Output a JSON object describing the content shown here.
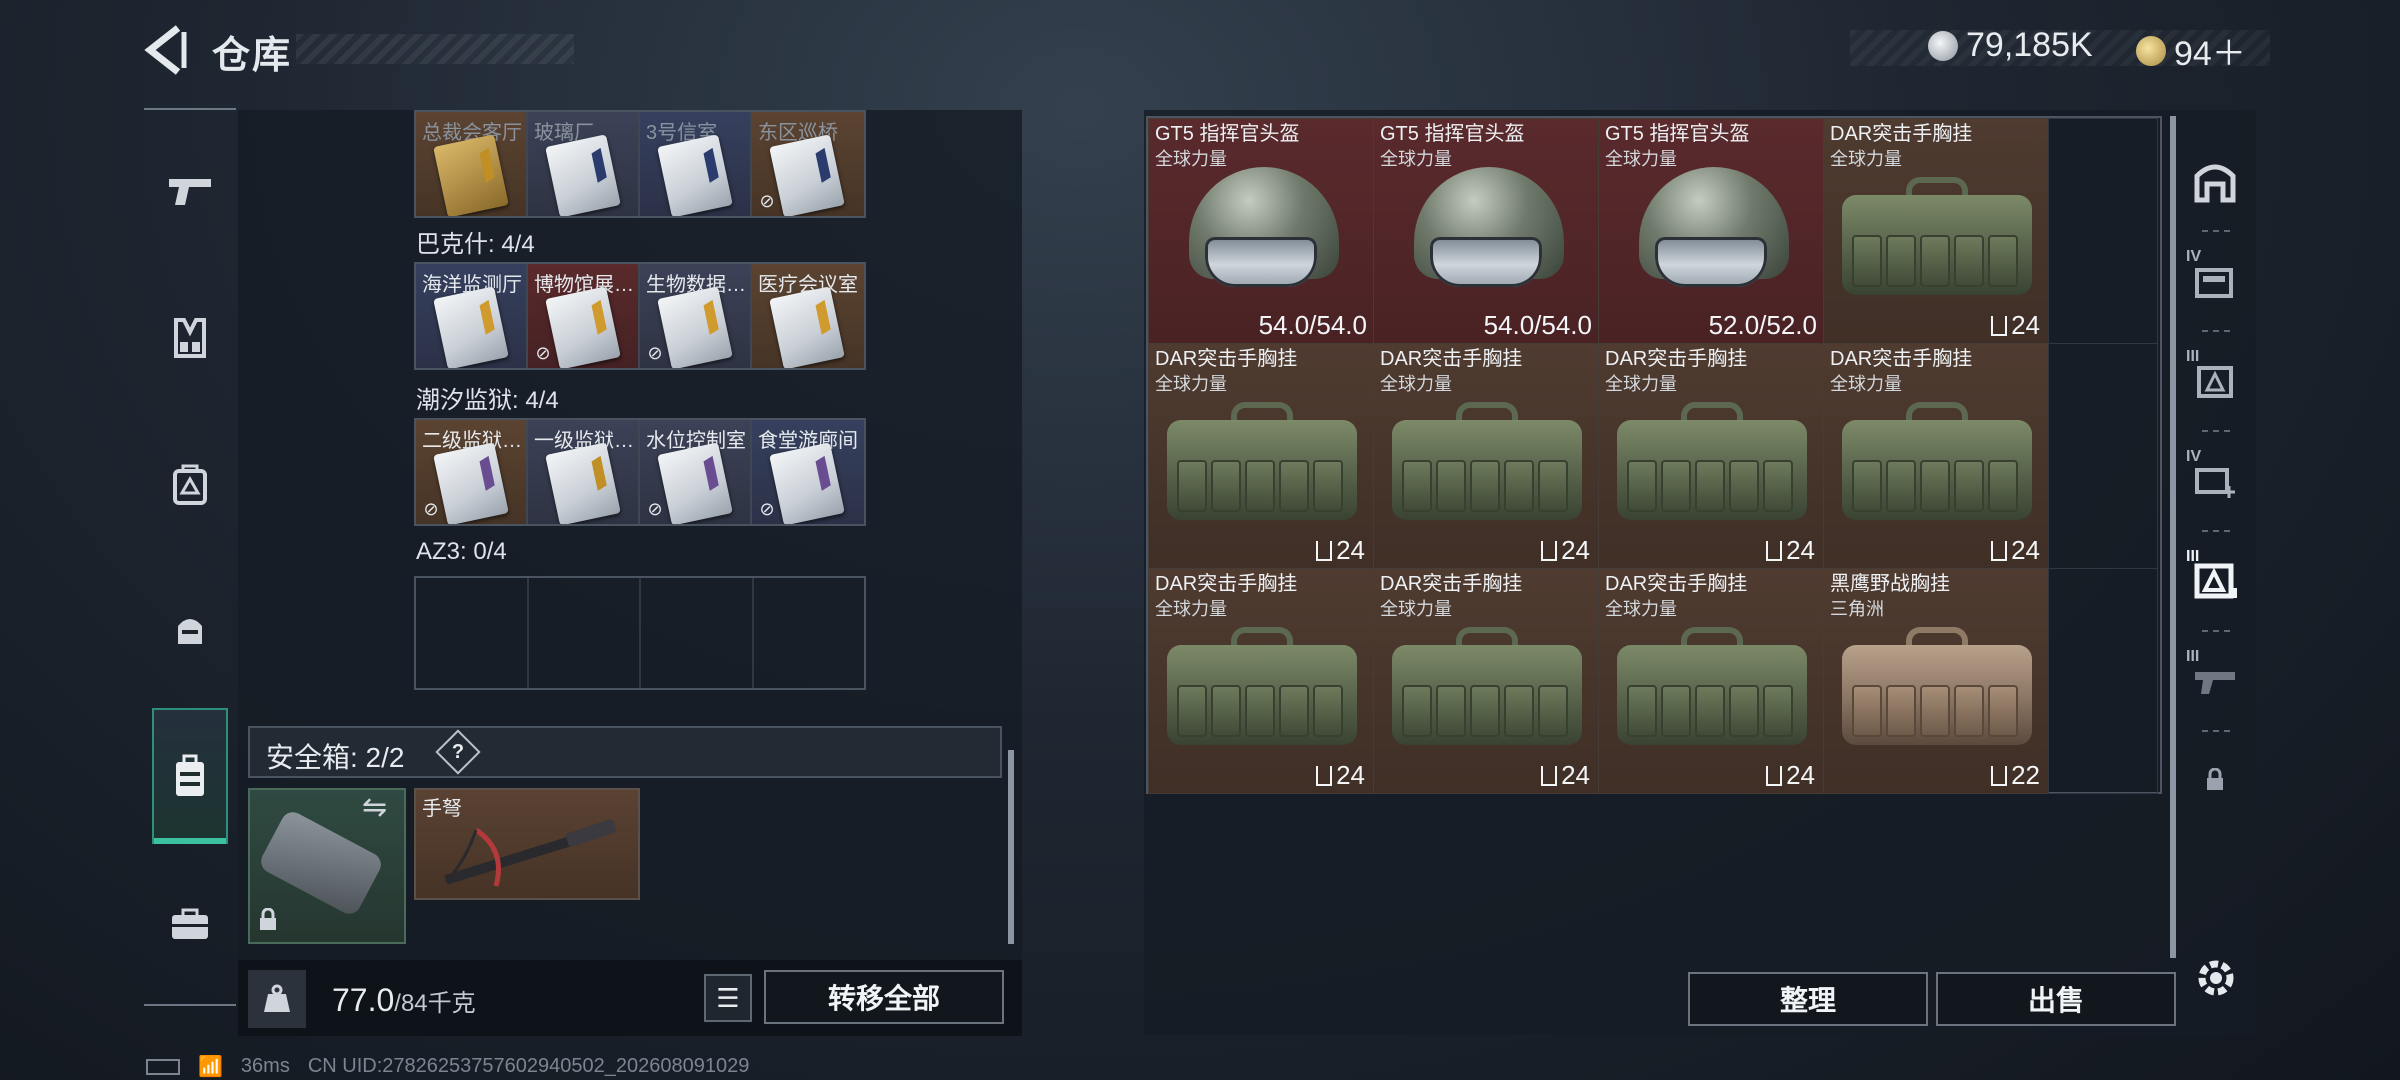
{
  "header": {
    "title": "仓库",
    "silver_amount": "79,185K",
    "gold_amount": "94＋"
  },
  "left_rail": {
    "items": [
      "pistol-icon",
      "vest-icon",
      "backpack-icon",
      "pouch-icon",
      "safe-case-icon",
      "toolbox-icon"
    ],
    "active_index": 4
  },
  "key_sections": [
    {
      "label": "",
      "slots": [
        {
          "label": "总裁会客厅",
          "bg": "brown",
          "card": "gold-body",
          "restricted": false,
          "dim": true
        },
        {
          "label": "玻璃厂",
          "bg": "slate",
          "card": "blue",
          "restricted": false,
          "dim": true
        },
        {
          "label": "3号信室",
          "bg": "blue",
          "card": "blue",
          "restricted": false,
          "dim": true
        },
        {
          "label": "东区巡桥",
          "bg": "brown",
          "card": "blue",
          "restricted": true,
          "dim": true
        }
      ]
    },
    {
      "label": "巴克什: 4/4",
      "slots": [
        {
          "label": "海洋监测厅",
          "bg": "blue",
          "card": "amber",
          "restricted": false
        },
        {
          "label": "博物馆展…",
          "bg": "red",
          "card": "amber",
          "restricted": true
        },
        {
          "label": "生物数据…",
          "bg": "slate",
          "card": "amber",
          "restricted": true
        },
        {
          "label": "医疗会议室",
          "bg": "brown",
          "card": "amber",
          "restricted": false
        }
      ]
    },
    {
      "label": "潮汐监狱: 4/4",
      "slots": [
        {
          "label": "二级监狱…",
          "bg": "brown",
          "card": "purple",
          "restricted": true
        },
        {
          "label": "一级监狱…",
          "bg": "slate",
          "card": "gold",
          "restricted": false
        },
        {
          "label": "水位控制室",
          "bg": "slate",
          "card": "purple",
          "restricted": true
        },
        {
          "label": "食堂游廊间",
          "bg": "blue",
          "card": "purple",
          "restricted": true
        }
      ]
    },
    {
      "label": "AZ3: 0/4",
      "slots": []
    }
  ],
  "safebox": {
    "label": "安全箱: 2/2",
    "help": "?",
    "swap_icon": "⇋",
    "lock_icon": "🔒",
    "crossbow_label": "手弩"
  },
  "weight": {
    "current": "77.0",
    "max": "/84千克"
  },
  "buttons": {
    "transfer_all": "转移全部",
    "sort": "整理",
    "sell": "出售",
    "list_icon": "☰"
  },
  "stash_items": [
    {
      "name": "GT5 指挥官头盔",
      "sub": "全球力量",
      "type": "helmet",
      "value": "54.0/54.0",
      "bg": "red"
    },
    {
      "name": "GT5 指挥官头盔",
      "sub": "全球力量",
      "type": "helmet",
      "value": "54.0/54.0",
      "bg": "red"
    },
    {
      "name": "GT5 指挥官头盔",
      "sub": "全球力量",
      "type": "helmet",
      "value": "52.0/52.0",
      "bg": "red"
    },
    {
      "name": "DAR突击手胸挂",
      "sub": "全球力量",
      "type": "vest",
      "value": "24",
      "bg": "brown"
    },
    {
      "name": "DAR突击手胸挂",
      "sub": "全球力量",
      "type": "vest",
      "value": "24",
      "bg": "brown"
    },
    {
      "name": "DAR突击手胸挂",
      "sub": "全球力量",
      "type": "vest",
      "value": "24",
      "bg": "brown"
    },
    {
      "name": "DAR突击手胸挂",
      "sub": "全球力量",
      "type": "vest",
      "value": "24",
      "bg": "brown"
    },
    {
      "name": "DAR突击手胸挂",
      "sub": "全球力量",
      "type": "vest",
      "value": "24",
      "bg": "brown"
    },
    {
      "name": "DAR突击手胸挂",
      "sub": "全球力量",
      "type": "vest",
      "value": "24",
      "bg": "brown"
    },
    {
      "name": "DAR突击手胸挂",
      "sub": "全球力量",
      "type": "vest",
      "value": "24",
      "bg": "brown"
    },
    {
      "name": "DAR突击手胸挂",
      "sub": "全球力量",
      "type": "vest",
      "value": "24",
      "bg": "brown"
    },
    {
      "name": "黑鹰野战胸挂",
      "sub": "三角洲",
      "type": "vest-tan",
      "value": "22",
      "bg": "brown"
    }
  ],
  "right_rail": {
    "items": [
      {
        "icon": "home-arch-icon",
        "roman": ""
      },
      {
        "icon": "tier-iv-folder-icon",
        "roman": "IV"
      },
      {
        "icon": "tier-iii-tag-icon",
        "roman": "III"
      },
      {
        "icon": "tier-iv-add-icon",
        "roman": "IV"
      },
      {
        "icon": "tier-iii-active-icon",
        "roman": "III"
      },
      {
        "icon": "tier-iii-weapon-icon",
        "roman": "III"
      },
      {
        "icon": "lock-icon",
        "roman": ""
      }
    ]
  },
  "status": {
    "ping": "36ms",
    "uid": "CN UID:2782625375760294050​2_202608091029"
  },
  "colors": {
    "accent": "#3cc19f",
    "item_red": "#5a2a2d",
    "item_brown": "#4f3b30"
  }
}
